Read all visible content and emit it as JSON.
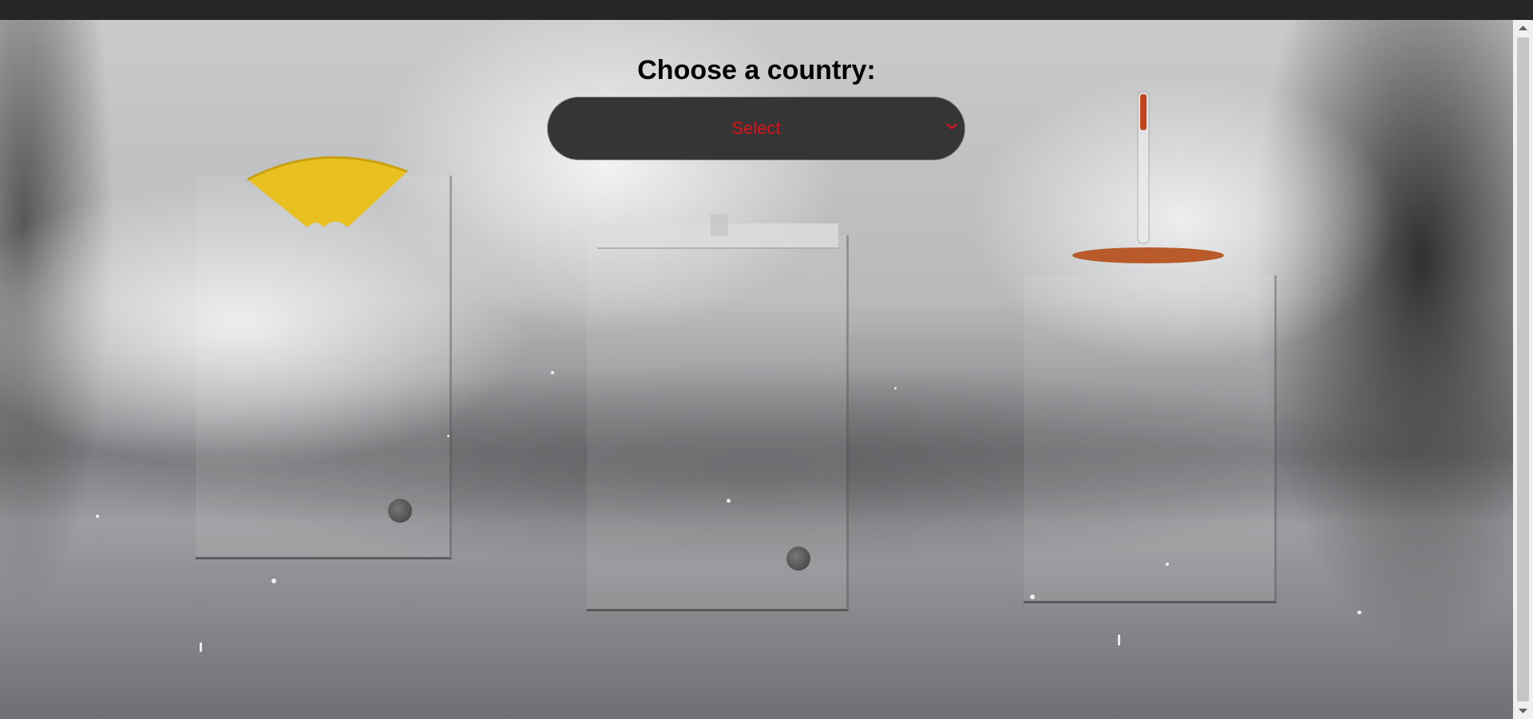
{
  "page": {
    "heading": "Choose a country:"
  },
  "country_select": {
    "selected_label": "Select"
  },
  "colors": {
    "select_background": "#353535",
    "select_text": "#e0101a",
    "umbrella": "#e8c020",
    "weather_accent": "#b85a2a"
  },
  "icons": {
    "dropdown": "chevron-down-icon",
    "scroll_up": "triangle-up-icon",
    "scroll_down": "triangle-down-icon"
  }
}
